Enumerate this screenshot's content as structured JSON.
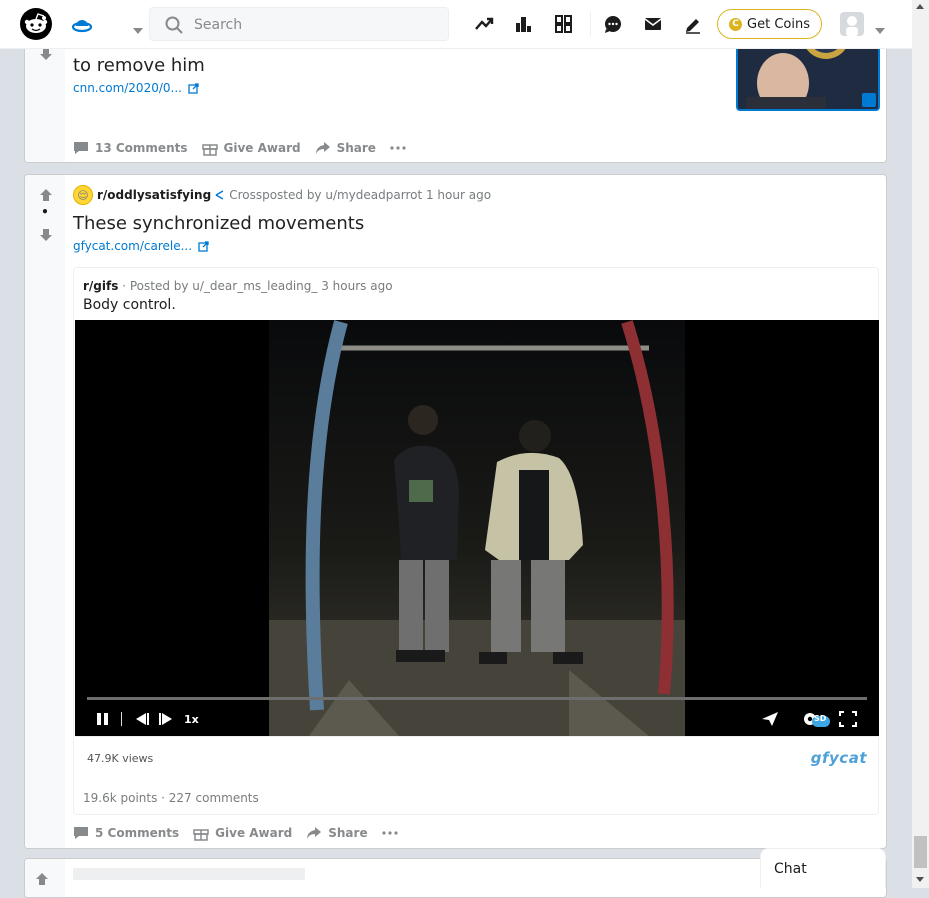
{
  "header": {
    "search_placeholder": "Search",
    "get_coins_label": "Get Coins",
    "coin_glyph": "C",
    "icons": [
      "reddit-logo",
      "home-icon",
      "trending-icon",
      "leaderboard-icon",
      "rpan-icon",
      "chat-icon",
      "mail-icon",
      "create-post-icon",
      "avatar",
      "chevron-down-icon"
    ]
  },
  "post1": {
    "title": "to remove him",
    "link": "cnn.com/2020/0...",
    "comments": "13 Comments",
    "award": "Give Award",
    "share": "Share"
  },
  "post2": {
    "subreddit": "r/oddlysatisfying",
    "crossposted": "Crossposted by u/mydeadparrot 1 hour ago",
    "title": "These synchronized movements",
    "link": "gfycat.com/carele...",
    "comments": "5 Comments",
    "award": "Give Award",
    "share": "Share",
    "embedded": {
      "subreddit": "r/gifs",
      "posted_by": "· Posted by u/_dear_ms_leading_ 3 hours ago",
      "title": "Body control.",
      "speed": "1x",
      "quality": "SD",
      "views": "47.9K views",
      "brand": "gfycat",
      "stats": "19.6k points · 227 comments"
    }
  },
  "chat": {
    "label": "Chat"
  },
  "colors": {
    "accent": "#0079d3",
    "coin": "#dbb420",
    "brand_gfycat": "#4fa1d8"
  }
}
